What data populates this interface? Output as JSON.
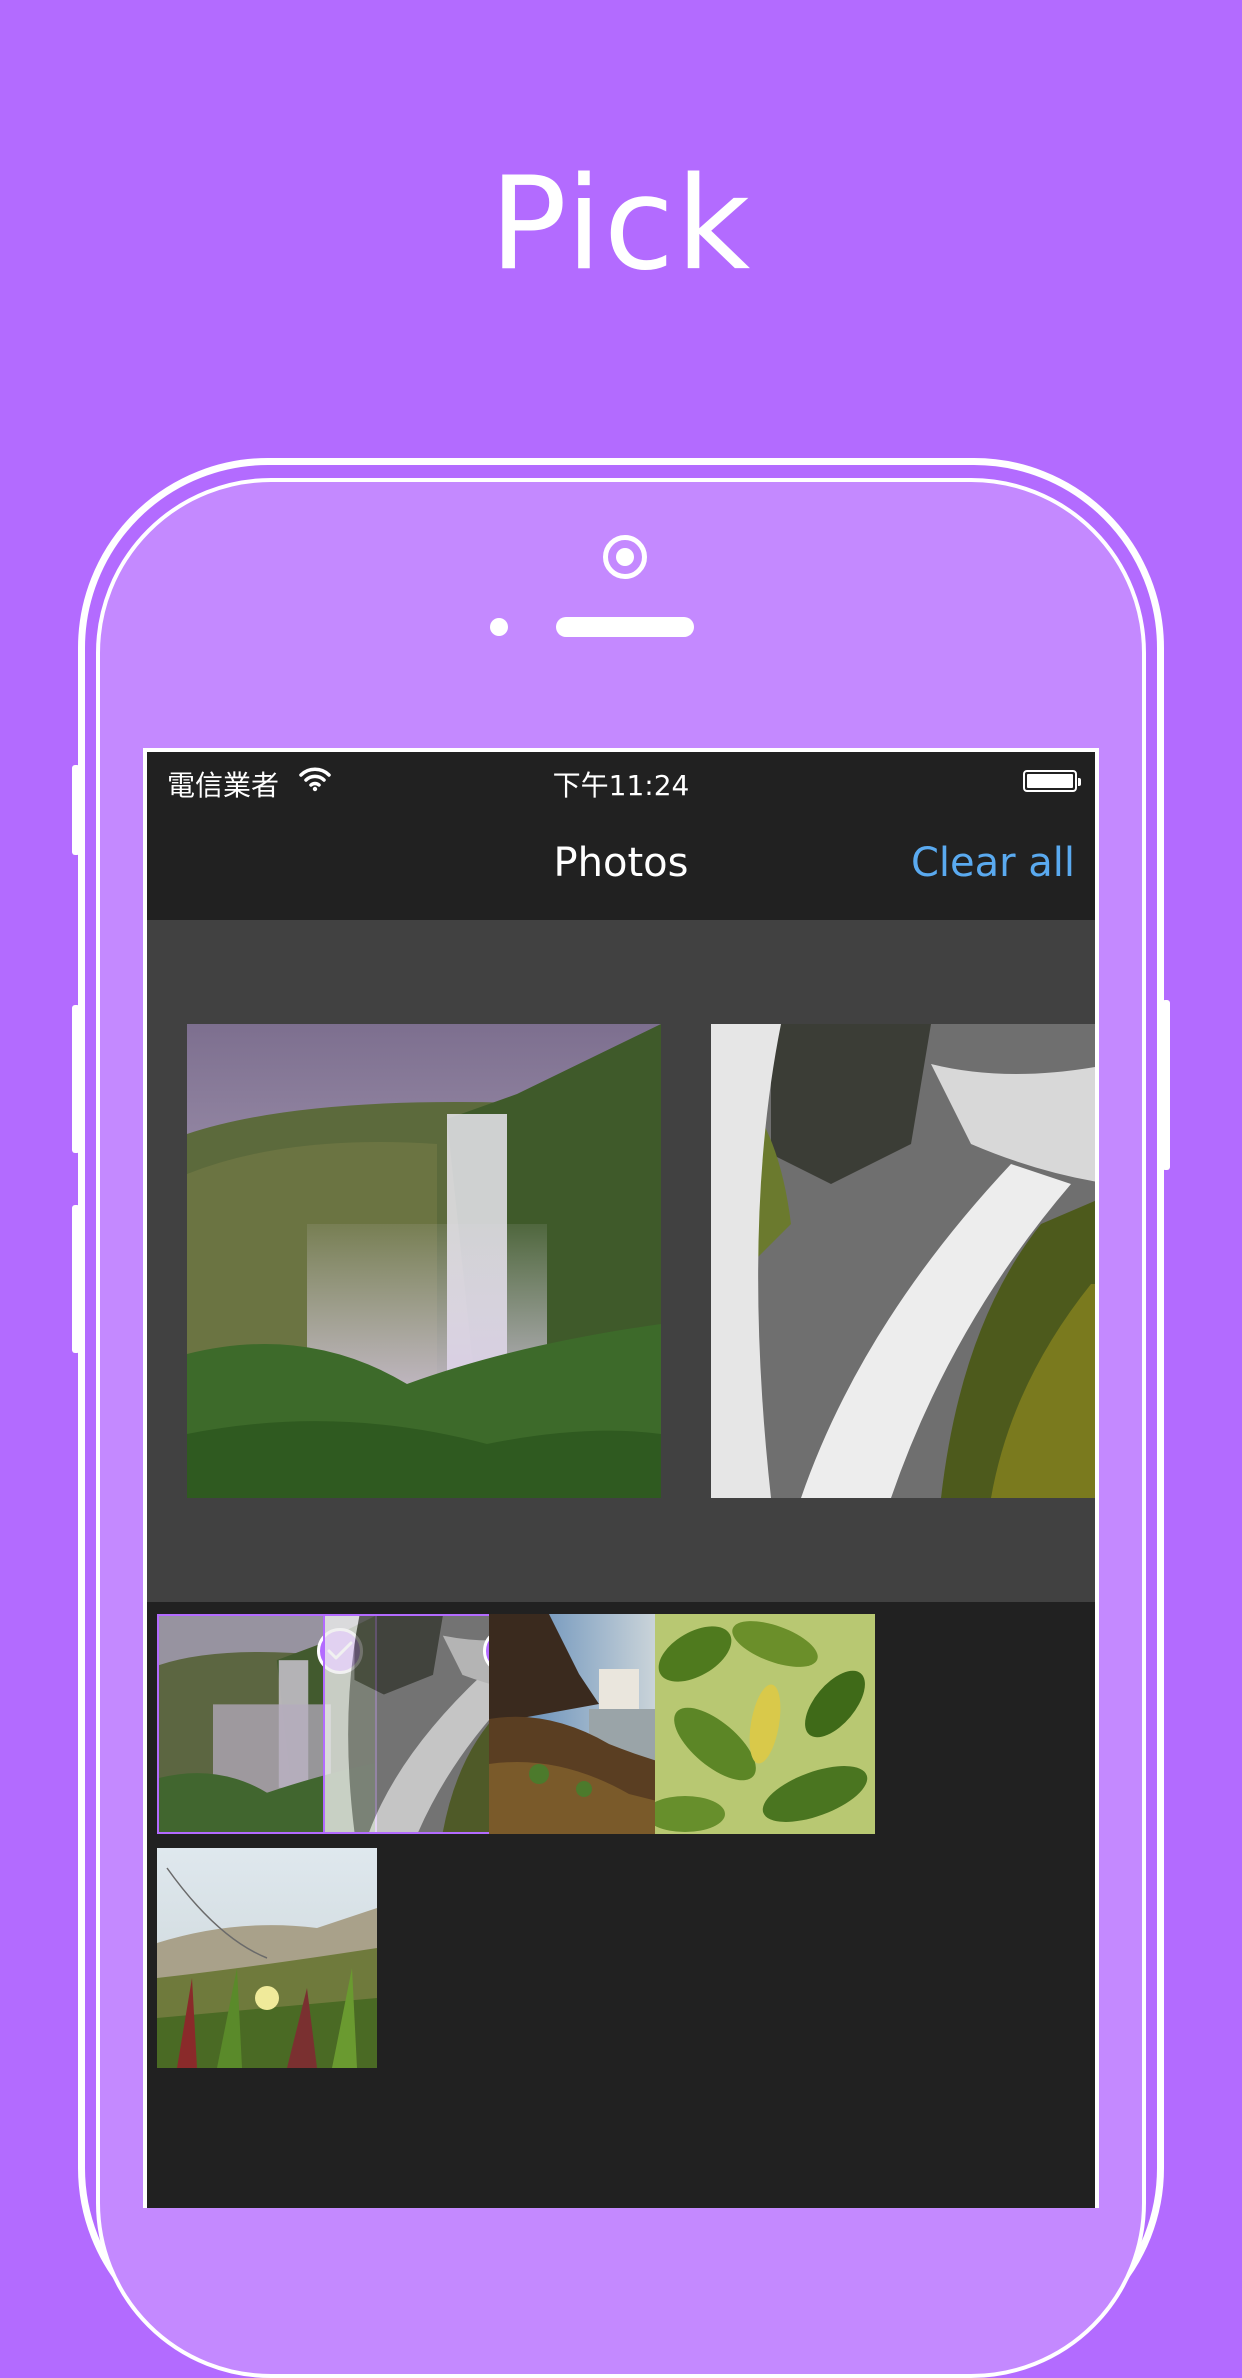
{
  "headline": "Pick",
  "status_bar": {
    "carrier": "電信業者",
    "time": "下午11:24"
  },
  "nav": {
    "title": "Photos",
    "clear_all": "Clear all"
  },
  "preview_photos": [
    {
      "subject": "waterfall-valley"
    },
    {
      "subject": "waterfall-rocks"
    }
  ],
  "thumbnails": [
    {
      "subject": "waterfall-valley",
      "selected": true
    },
    {
      "subject": "waterfall-rocks",
      "selected": true
    },
    {
      "subject": "waterfall-coast",
      "selected": false
    },
    {
      "subject": "green-leaves",
      "selected": false
    },
    {
      "subject": "dune-grass",
      "selected": false
    }
  ],
  "colors": {
    "background": "#b36bff",
    "accent_link": "#5aaaf0",
    "screen": "#212121",
    "preview_area": "#414141"
  }
}
